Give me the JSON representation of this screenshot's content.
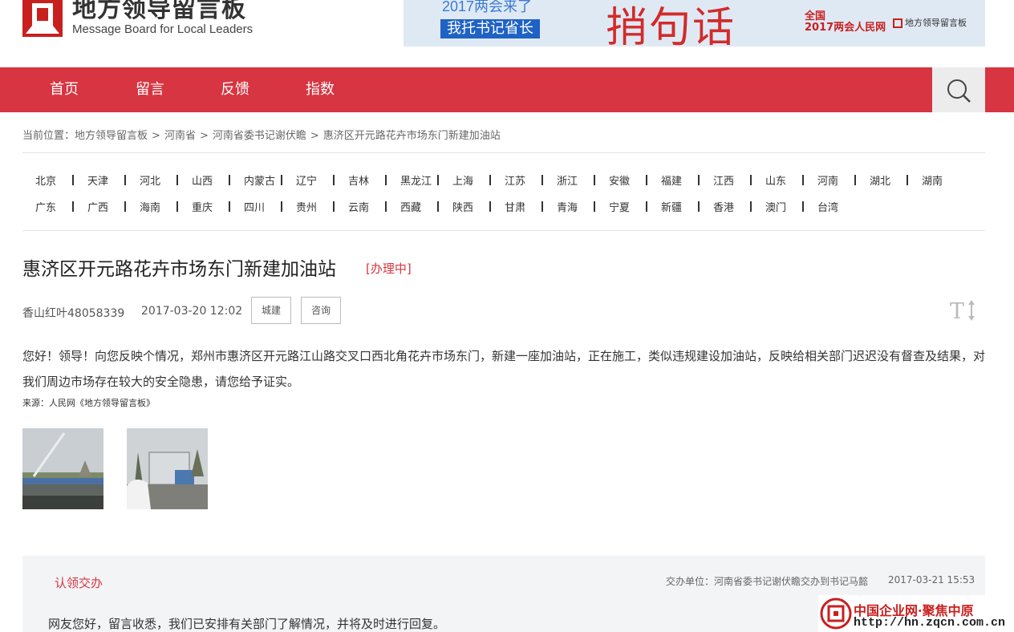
{
  "header": {
    "logo_cn": "地方领导留言板",
    "logo_en": "Message Board for Local Leaders",
    "banner": {
      "line1": "2017两会来了",
      "box": "我托书记省长",
      "big": "捎句话",
      "tag_line1": "全国",
      "tag_line2": "2017两会人民网",
      "logo_text": "地方领导留言板"
    }
  },
  "nav": {
    "items": [
      "首页",
      "留言",
      "反馈",
      "指数"
    ],
    "search_icon": "search-icon"
  },
  "breadcrumb": {
    "prefix": "当前位置：",
    "items": [
      "地方领导留言板",
      "河南省",
      "河南省委书记谢伏瞻",
      "惠济区开元路花卉市场东门新建加油站"
    ],
    "separator": ">"
  },
  "provinces": {
    "row1": [
      "北京",
      "天津",
      "河北",
      "山西",
      "内蒙古",
      "辽宁",
      "吉林",
      "黑龙江",
      "上海",
      "江苏",
      "浙江",
      "安徽",
      "福建",
      "江西",
      "山东",
      "河南",
      "湖北",
      "湖南"
    ],
    "row2": [
      "广东",
      "广西",
      "海南",
      "重庆",
      "四川",
      "贵州",
      "云南",
      "西藏",
      "陕西",
      "甘肃",
      "青海",
      "宁夏",
      "新疆",
      "香港",
      "澳门",
      "台湾"
    ]
  },
  "message": {
    "title": "惠济区开元路花卉市场东门新建加油站",
    "status": "[办理中]",
    "author": "香山红叶48058339",
    "datetime": "2017-03-20 12:02",
    "tags": [
      "城建",
      "咨询"
    ],
    "body": "您好！领导！向您反映个情况，郑州市惠济区开元路江山路交叉口西北角花卉市场东门，新建一座加油站，正在施工，类似违规建设加油站，反映给相关部门迟迟没有督查及结果，对我们周边市场存在较大的安全隐患，请您给予证实。",
    "source": "来源：人民网《地方领导留言板》",
    "font_toggle_icon": "font-size-icon"
  },
  "reply": {
    "title": "认领交办",
    "unit": "交办单位：河南省委书记谢伏瞻交办到书记马懿",
    "date": "2017-03-21 15:53",
    "text": "网友您好，留言收悉，我们已安排有关部门了解情况，并将及时进行回复。"
  },
  "watermark": {
    "line1": "中国企业网·聚焦中原",
    "line2": "http://hn.zqcn.com.cn"
  },
  "colors": {
    "accent": "#d73541",
    "text": "#333333",
    "muted": "#666666"
  }
}
